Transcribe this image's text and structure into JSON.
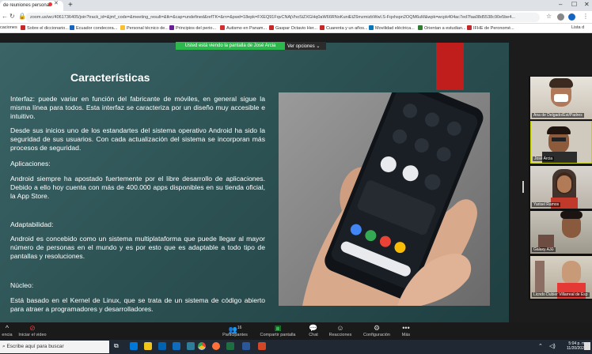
{
  "browser": {
    "tab_title": "de reuniones personal",
    "url": "zoom.us/wc/4061736405/join?track_id=&jmf_code=&meeting_result=&tk=&cap=undefined&refTK=&rn=&pwd=18epk=FXEQ91FqvCNAjVhoSiZXGHq0aW66RNoKuniEtZ6mzmizbWwl.S-Fqxhspn2OQM6uM&wpk=wcpk404ac7ed7faa08d5538c90e5be4...",
    "bookmarks": [
      "caciones",
      "Sobre el diccionario...",
      "Ecuador condecora...",
      "Personal técnico de...",
      "Principios del perio...",
      "Autismo en Panam...",
      "Gaspar Octavio Her...",
      "Cuarenta y un años...",
      "Movilidad eléctrica...",
      "Orientan a estudian...",
      "IFHE de Peronomé...",
      "Lista d"
    ]
  },
  "zoom": {
    "sharing_banner": "Usted está viendo la pantalla de José Arcia",
    "view_options": "Ver opciones",
    "participants": [
      {
        "name": "Ana de Delgado/Est/Padres"
      },
      {
        "name": "José Arcia"
      },
      {
        "name": "Yarisel Ramos"
      },
      {
        "name": "Galaxy A30"
      },
      {
        "name": "Licndo Dubier Villarreal de Esp"
      }
    ],
    "participant_count": "16",
    "toolbar": {
      "left_partial": "encia",
      "video": "Iniciar el video",
      "participants": "Participantes",
      "share": "Compartir pantalla",
      "chat": "Chat",
      "reactions": "Reacciones",
      "settings": "Configuración",
      "more": "Más"
    }
  },
  "slide": {
    "title": "Características",
    "paragraphs": [
      "Interfaz: puede variar en función del fabricante de móviles, en general sigue la misma línea para todos.  Esta interfaz se caracteriza por un diseño muy accesible e intuitivo.",
      "  Desde sus inicios uno de los estandartes del sistema operativo Android ha sido la seguridad de sus usuarios. Con cada actualización del sistema se incorporan más procesos de seguridad.",
      "Aplicaciones:",
      "Android siempre ha apostado fuertemente por el libre desarrollo de aplicaciones. Debido a ello hoy cuenta con más de 400.000 apps disponibles en su tienda oficial, la App Store.",
      "Adaptabilidad:",
      "Android es concebido como un sistema multiplataforma que puede llegar al mayor número de personas en el mundo y es por esto que es adaptable a todo tipo de pantallas y resoluciones.",
      "Núcleo:",
      "Está basado en el Kernel de Linux, que se trata de un sistema de código abierto para atraer a programadores y desarrolladores."
    ],
    "phone_tiles": [
      "Bluetooth",
      "Do not disturb",
      "Flashlight",
      "Auto-rotate",
      "Battery Saver",
      "Mobile data",
      "Dark Theme",
      "Airplane mode"
    ],
    "phone_time": "10:30"
  },
  "taskbar": {
    "search_placeholder": "Escribe aquí para buscar",
    "time": "5:04 p. m.",
    "date": "11/20/2020"
  }
}
